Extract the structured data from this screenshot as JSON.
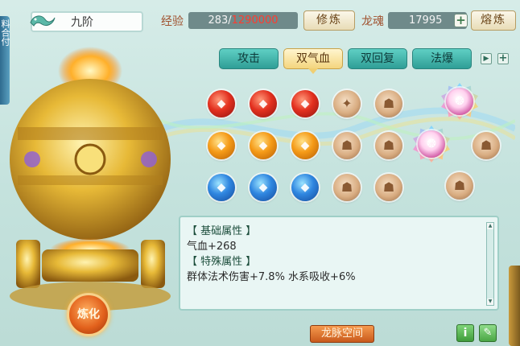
{
  "side_tab_text": "料合付",
  "rank": {
    "label": "九阶"
  },
  "experience": {
    "label": "经验",
    "current": "283/",
    "max": "1290000",
    "button": "修炼"
  },
  "dragon_soul": {
    "label": "龙魂",
    "value": "17995",
    "plus": "+",
    "button": "熔炼"
  },
  "tabs": [
    {
      "label": "攻击",
      "active": false
    },
    {
      "label": "双气血",
      "active": true
    },
    {
      "label": "双回复",
      "active": false
    },
    {
      "label": "法爆",
      "active": false
    }
  ],
  "tab_controls": {
    "next": "▶",
    "add": "+"
  },
  "info": {
    "base_header": "【 基础属性 】",
    "base_value": "气血+268",
    "special_header": "【 特殊属性 】",
    "special_value": "群体法术伤害+7.8% 水系吸收+6%"
  },
  "buttons": {
    "refine": "炼化",
    "dragon_space": "龙脉空间",
    "info": "i",
    "edit": "✎"
  },
  "colors": {
    "teal_tab": "#2f9e96",
    "gold_tab": "#f4d57e",
    "red_number": "#ff3b2f",
    "label_brown": "#a0512e"
  }
}
